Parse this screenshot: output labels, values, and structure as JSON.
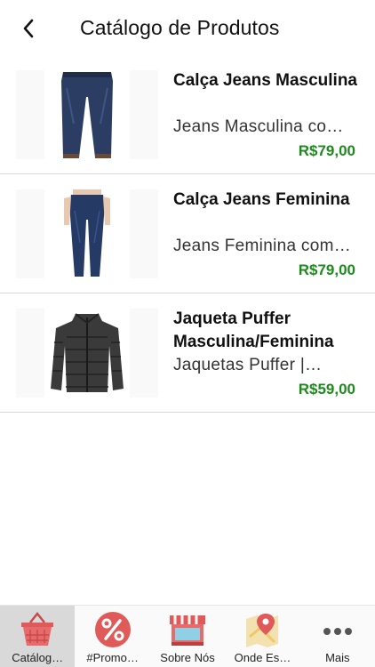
{
  "header": {
    "title": "Catálogo de Produtos"
  },
  "products": [
    {
      "title": "Calça Jeans Masculina",
      "description": "Jeans Masculina co…",
      "price": "R$79,00",
      "image": "mens-jeans"
    },
    {
      "title": "Calça Jeans Feminina",
      "description": "Jeans Feminina com…",
      "price": "R$79,00",
      "image": "womens-jeans"
    },
    {
      "title": "Jaqueta Puffer Masculina/Feminina",
      "description": "Jaquetas Puffer |…",
      "price": "R$59,00",
      "image": "puffer-jacket"
    }
  ],
  "tabbar": {
    "tabs": [
      {
        "label": "Catálog…",
        "icon": "basket-icon",
        "active": true
      },
      {
        "label": "#Promo…",
        "icon": "percent-icon",
        "active": false
      },
      {
        "label": "Sobre Nós",
        "icon": "store-icon",
        "active": false
      },
      {
        "label": "Onde Es…",
        "icon": "map-pin-icon",
        "active": false
      },
      {
        "label": "Mais",
        "icon": "more-icon",
        "active": false
      }
    ]
  },
  "colors": {
    "price": "#1e8a1e",
    "accent": "#e05a5a"
  }
}
